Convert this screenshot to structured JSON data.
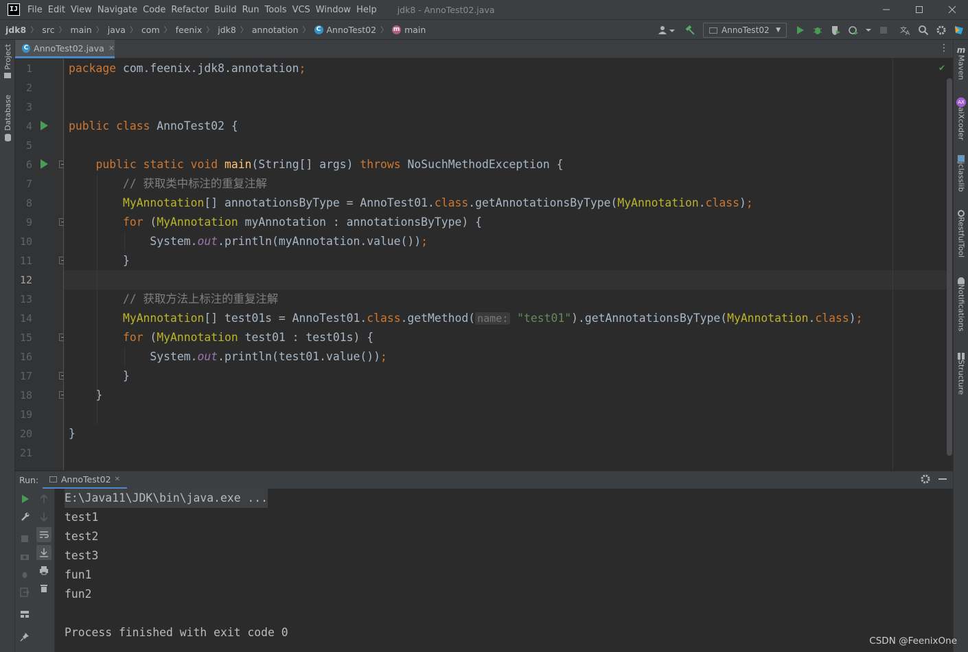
{
  "titlebar": {
    "logo": "IJ",
    "menu": [
      "File",
      "Edit",
      "View",
      "Navigate",
      "Code",
      "Refactor",
      "Build",
      "Run",
      "Tools",
      "VCS",
      "Window",
      "Help"
    ],
    "window_title": "jdk8 - AnnoTest02.java"
  },
  "breadcrumbs": {
    "project": "jdk8",
    "items": [
      "src",
      "main",
      "java",
      "com",
      "feenix",
      "jdk8",
      "annotation"
    ],
    "class": "AnnoTest02",
    "method": "main"
  },
  "toolbar": {
    "run_config": "AnnoTest02"
  },
  "left_tool_windows": [
    "Project",
    "Database"
  ],
  "right_tool_windows": [
    "Maven",
    "aiXcoder",
    "jclasslib",
    "RestfulTool",
    "Notifications",
    "Structure"
  ],
  "editor": {
    "tab_label": "AnnoTest02.java",
    "current_line": 12,
    "line_numbers": [
      "1",
      "2",
      "3",
      "4",
      "5",
      "6",
      "7",
      "8",
      "9",
      "10",
      "11",
      "12",
      "13",
      "14",
      "15",
      "16",
      "17",
      "18",
      "19",
      "20",
      "21"
    ],
    "param_hint": "name:",
    "lines": [
      "package com.feenix.jdk8.annotation;",
      "",
      "",
      "public class AnnoTest02 {",
      "",
      "    public static void main(String[] args) throws NoSuchMethodException {",
      "        // 获取类中标注的重复注解",
      "        MyAnnotation[] annotationsByType = AnnoTest01.class.getAnnotationsByType(MyAnnotation.class);",
      "        for (MyAnnotation myAnnotation : annotationsByType) {",
      "            System.out.println(myAnnotation.value());",
      "        }",
      "",
      "        // 获取方法上标注的重复注解",
      "        MyAnnotation[] test01s = AnnoTest01.class.getMethod(name: \"test01\").getAnnotationsByType(MyAnnotation.class);",
      "        for (MyAnnotation test01 : test01s) {",
      "            System.out.println(test01.value());",
      "        }",
      "    }",
      "",
      "}",
      ""
    ]
  },
  "run_panel": {
    "label": "Run:",
    "tab_label": "AnnoTest02",
    "output": [
      "E:\\Java11\\JDK\\bin\\java.exe ...",
      "test1",
      "test2",
      "test3",
      "fun1",
      "fun2",
      "",
      "Process finished with exit code 0"
    ]
  },
  "watermark": "CSDN @FeenixOne",
  "colors": {
    "keyword": "#cc7832",
    "method_decl": "#ffc66d",
    "annotation_type": "#bbb529",
    "string": "#6a8759",
    "comment": "#808080",
    "static_field": "#9876aa",
    "run_green": "#499c54",
    "accent_blue": "#4a88c7"
  }
}
